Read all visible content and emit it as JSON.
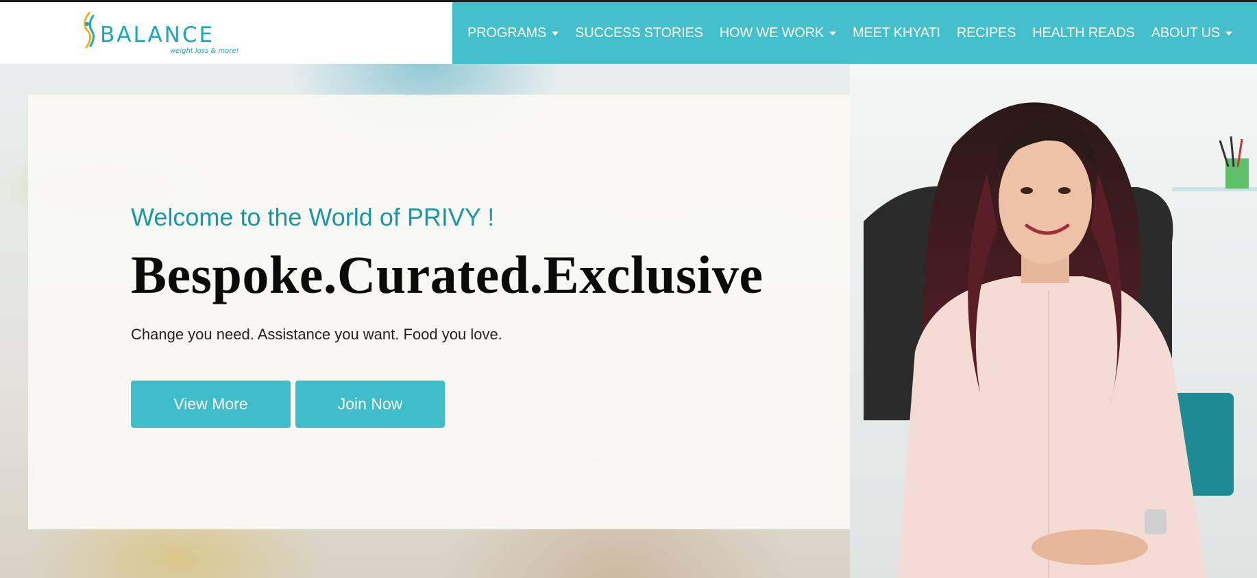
{
  "brand": {
    "name": "BALANCE",
    "tagline": "weight loss & more!",
    "color": "#1aa7b7"
  },
  "nav": {
    "background": "#42bfcb",
    "items": [
      {
        "label": "PROGRAMS",
        "dropdown": true
      },
      {
        "label": "SUCCESS STORIES",
        "dropdown": false
      },
      {
        "label": "HOW WE WORK",
        "dropdown": true
      },
      {
        "label": "MEET KHYATI",
        "dropdown": false
      },
      {
        "label": "RECIPES",
        "dropdown": false
      },
      {
        "label": "HEALTH READS",
        "dropdown": false
      },
      {
        "label": "ABOUT US",
        "dropdown": true
      }
    ]
  },
  "hero": {
    "welcome": "Welcome to the World of PRIVY !",
    "headline": "Bespoke.Curated.Exclusive",
    "subtext": "Change you need. Assistance you want. Food you love.",
    "buttons": {
      "view_more": "View More",
      "join_now": "Join Now"
    },
    "accent_color": "#3fbdca"
  }
}
